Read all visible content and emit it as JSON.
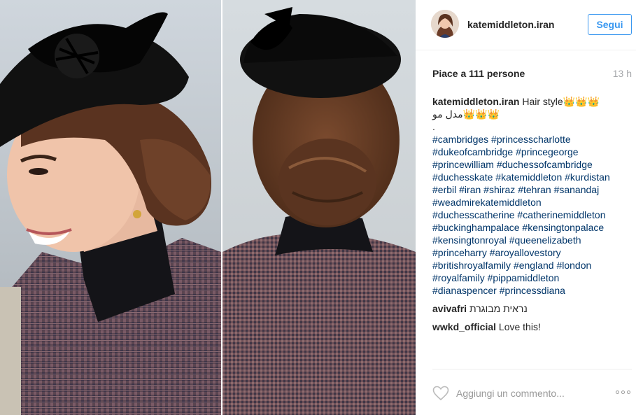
{
  "post": {
    "username": "katemiddleton.iran",
    "follow_label": "Segui",
    "likes_label": "Piace a 111 persone",
    "time_label": "13 h"
  },
  "caption": {
    "username": "katemiddleton.iran",
    "text": "Hair style👑👑👑",
    "line2": "مدل مو👑👑👑",
    "line3": ".",
    "hashtag_lines": [
      [
        "#cambridges",
        "#princesscharlotte"
      ],
      [
        "#dukeofcambridge",
        "#princegeorge"
      ],
      [
        "#princewilliam",
        "#duchessofcambridge"
      ],
      [
        "#duchesskate",
        "#katemiddleton",
        "#kurdistan"
      ],
      [
        "#erbil",
        "#iran",
        "#shiraz",
        "#tehran",
        "#sanandaj"
      ],
      [
        "#weadmirekatemiddleton"
      ],
      [
        "#duchesscatherine",
        "#catherinemiddleton"
      ],
      [
        "#buckinghampalace",
        "#kensingtonpalace"
      ],
      [
        "#kensingtonroyal",
        "#queenelizabeth"
      ],
      [
        "#princeharry",
        "#aroyallovestory"
      ],
      [
        "#britishroyalfamily",
        "#england",
        "#london"
      ],
      [
        "#royalfamily",
        "#pippamiddleton"
      ],
      [
        "#dianaspencer",
        "#princessdiana"
      ]
    ]
  },
  "comments": [
    {
      "username": "avivafri",
      "text": "נראית מבוגרת"
    },
    {
      "username": "wwkd_official",
      "text": "Love this!"
    }
  ],
  "footer": {
    "comment_placeholder": "Aggiungi un commento...",
    "like_icon": "heart-outline-icon",
    "more_icon": "more-options-icon"
  },
  "colors": {
    "accent": "#3897f0",
    "hashtag": "#003569",
    "muted": "#a5a7aa"
  }
}
